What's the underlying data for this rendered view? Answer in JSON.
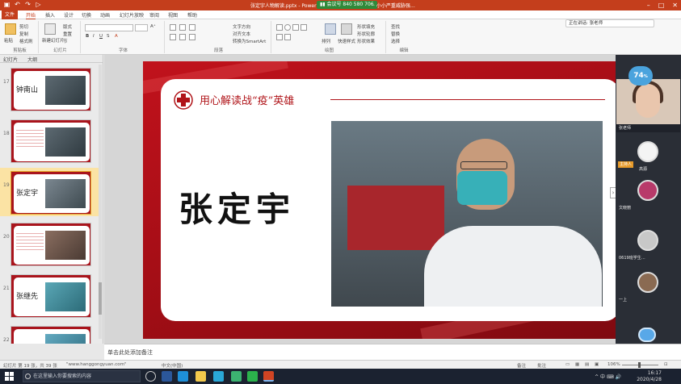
{
  "titlebar": {
    "doc_title": "张定宇人物解读.pptx - PowerPoint",
    "meeting_badge": "▮▮ 会议号 840 580 706",
    "meeting_extra": "· 小小严重威胁强…",
    "minimize": "–",
    "maximize": "□",
    "close": "✕"
  },
  "tabs": [
    "文件",
    "开始",
    "插入",
    "设计",
    "切换",
    "动画",
    "幻灯片放映",
    "审阅",
    "视图",
    "帮助"
  ],
  "active_tab": "开始",
  "ribbon": {
    "groups": [
      {
        "label": "剪贴板",
        "buttons": [
          "粘贴",
          "剪切",
          "复制",
          "格式刷"
        ]
      },
      {
        "label": "幻灯片",
        "buttons": [
          "新建幻灯片",
          "版式",
          "重置",
          "节"
        ]
      },
      {
        "label": "字体",
        "font_name": "",
        "font_size": ""
      },
      {
        "label": "段落",
        "buttons": [
          "文字方向",
          "对齐文本",
          "转换为SmartArt"
        ]
      },
      {
        "label": "绘图",
        "buttons": [
          "排列",
          "快速样式",
          "形状填充",
          "形状轮廓",
          "形状效果"
        ]
      },
      {
        "label": "编辑",
        "buttons": [
          "查找",
          "替换",
          "选择"
        ]
      }
    ]
  },
  "meeting_top_pill": "正在讲话: 张老师",
  "nav_pane": {
    "tabs": [
      "幻灯片",
      "大纲"
    ],
    "slides": [
      {
        "num": "17",
        "name": "钟南山",
        "type": "name"
      },
      {
        "num": "18",
        "name": "",
        "type": "text"
      },
      {
        "num": "19",
        "name": "张定宇",
        "type": "name",
        "selected": true
      },
      {
        "num": "20",
        "name": "",
        "type": "text"
      },
      {
        "num": "21",
        "name": "张继先",
        "type": "name"
      },
      {
        "num": "22",
        "name": "",
        "type": "name"
      }
    ]
  },
  "slide": {
    "title": "用心解读战“疫”英雄",
    "hero_name": "张定宇"
  },
  "meeting_panel": {
    "score_badge": "74",
    "score_unit": "%",
    "host_name": "张老师",
    "teacher_tag": "主持人",
    "participants": [
      {
        "name": "高源"
      },
      {
        "name": "文晓丽"
      },
      {
        "name": "XXX学生"
      },
      {
        "name": "0619班学生…"
      },
      {
        "name": "一上"
      }
    ],
    "expand": "›"
  },
  "notes": {
    "text": "单击此处添加备注"
  },
  "statusbar": {
    "slide_info": "幻灯片 第 19 张，共 39 张",
    "lang": "中文(中国)",
    "website": "\"www.hanggongyuan.com\"",
    "notes_btn": "备注",
    "comments_btn": "批注",
    "zoom": "106%"
  },
  "taskbar": {
    "search_placeholder": "在这里输入你要搜索的内容",
    "time": "16:17",
    "date": "2020/4/28",
    "sys_tray": "^ 中 ⌨ 🔊"
  },
  "colors": {
    "powerpoint_red": "#c43e1c",
    "slide_red": "#b01419",
    "meeting_blue": "#4aa3dd",
    "taskbar": "#1b2230"
  }
}
